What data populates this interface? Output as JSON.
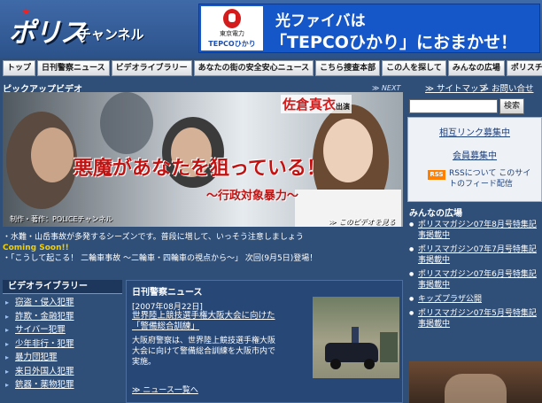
{
  "header": {
    "logo_main": "ポリス",
    "logo_sub": "チャンネル",
    "ad": {
      "company": "東京電力",
      "brand": "TEPCOひかり",
      "line1": "光ファイバは",
      "line2": "「TEPCOひかり」におまかせ！"
    }
  },
  "nav": [
    "トップ",
    "日刊警察ニュース",
    "ビデオライブラリー",
    "あなたの街の安全安心ニュース",
    "こちら捜査本部",
    "この人を探して",
    "みんなの広場",
    "ポリスチャンネルとは"
  ],
  "pickup": {
    "title": "ピックアップビデオ",
    "next": "≫ NEXT",
    "cast": "佐倉真衣",
    "cast_suffix": "出演",
    "headline": "悪魔があなたを狙っている！",
    "subtitle": "～行政対象暴力～",
    "credit": "制作・著作：POLICEチャンネル",
    "watch": "≫ このビデオを見る"
  },
  "ticker": {
    "line1": "・水難・山岳事故が多発するシーズンです。普段に増して、いっそう注意しましょう",
    "line2": "Coming Soon!!",
    "line3": "・「こうして起こる！ 二輪車事故 ～二輪車・四輪車の視点から～」 次回(9月5日)登場！"
  },
  "library": {
    "title": "ビデオライブラリー",
    "items": [
      "窃盗・侵入犯罪",
      "詐欺・金融犯罪",
      "サイバー犯罪",
      "少年非行・犯罪",
      "暴力団犯罪",
      "来日外国人犯罪",
      "銃器・薬物犯罪"
    ]
  },
  "news": {
    "title": "日刊警察ニュース",
    "date": "[2007年08月22日]",
    "headline": "世界陸上競技選手権大阪大会に向けた「警備総合訓練」",
    "body": "大阪府警察は、世界陸上競技選手権大阪大会に向けて警備総合訓練を大阪市内で実施。",
    "more": "≫ ニュース一覧へ"
  },
  "sidebar": {
    "sitemap": "≫ サイトマップ",
    "contact": "≫ お問い合せ",
    "search_button": "検索",
    "related_links": "相互リンク募集中",
    "members": "会員募集中",
    "rss_badge": "RSS",
    "rss_text": "RSSについて このサイトのフィード配信",
    "hiroba_title": "みんなの広場",
    "hiroba_items": [
      "ポリスマガジン07年8月号特集記事掲載中",
      "ポリスマガジン07年7月号特集記事掲載中",
      "ポリスマガジン07年6月号特集記事掲載中",
      "キッズプラザ公開",
      "ポリスマガジン07年5月号特集記事掲載中"
    ]
  }
}
